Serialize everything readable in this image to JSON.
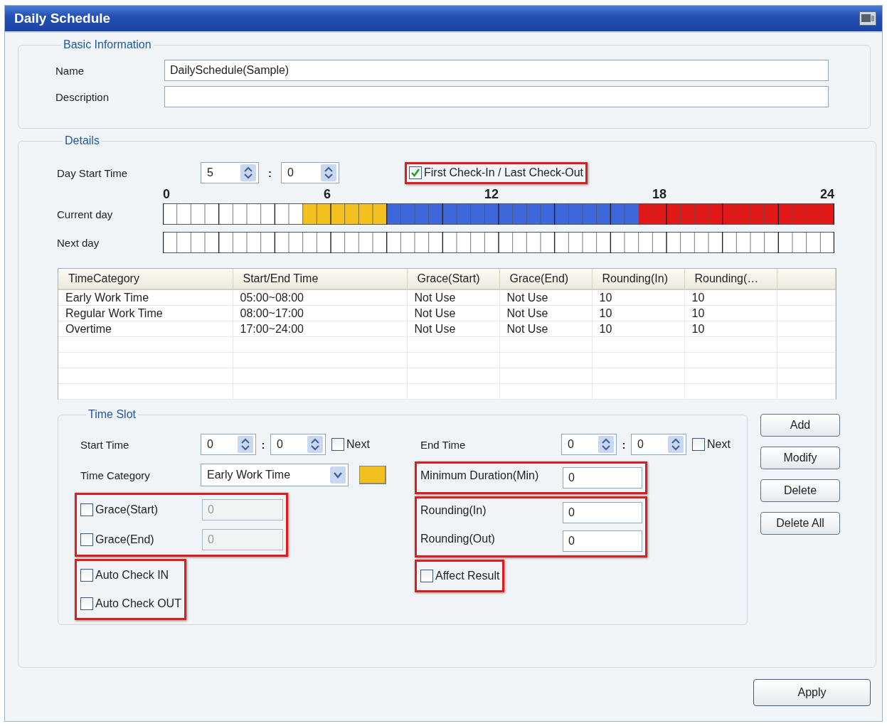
{
  "window": {
    "title": "Daily Schedule"
  },
  "basic_information": {
    "title": "Basic Information",
    "fields": [
      {
        "label": "Name",
        "value": "DailySchedule(Sample)"
      },
      {
        "label": "Description"
      }
    ]
  },
  "details": {
    "title": "Details",
    "day_start_time": {
      "label": "Day Start Time",
      "hour": "5",
      "separator": ":",
      "minute": "0"
    },
    "first_last_check": {
      "label": "First Check-In / Last Check-Out",
      "checked": true,
      "highlighted": true
    },
    "timeline": {
      "ticks": [
        "0",
        "6",
        "12",
        "18",
        "24"
      ],
      "rows": [
        {
          "label": "Current day",
          "filled": true
        },
        {
          "label": "Next day",
          "filled": false
        }
      ]
    },
    "table": {
      "columns": [
        "TimeCategory",
        "Start/End Time",
        "Grace(Start)",
        "Grace(End)",
        "Rounding(In)",
        "Rounding(…"
      ],
      "rows": [
        {
          "cells": [
            "Early Work Time",
            "05:00~08:00",
            "Not Use",
            "Not Use",
            "10",
            "10"
          ],
          "color": "#f2c01f"
        },
        {
          "cells": [
            "Regular Work Time",
            "08:00~17:00",
            "Not Use",
            "Not Use",
            "10",
            "10"
          ],
          "color": "#3f67dc"
        },
        {
          "cells": [
            "Overtime",
            "17:00~24:00",
            "Not Use",
            "Not Use",
            "10",
            "10"
          ],
          "color": "#e01818"
        }
      ]
    },
    "time_slot": {
      "title": "Time Slot",
      "left": [
        {
          "kind": "time",
          "label": "Start Time",
          "hour": "0",
          "separator": ":",
          "minute": "0",
          "next_label": "Next",
          "next_checked": false
        },
        {
          "kind": "dropdown",
          "label": "Time Category",
          "value": "Early Work Time",
          "color": "#f2c01f"
        },
        {
          "kind": "group",
          "highlighted": true,
          "items": [
            {
              "kind": "check_field",
              "label": "Grace(Start)",
              "checked": false,
              "value": "0",
              "disabled": true
            },
            {
              "kind": "check_field",
              "label": "Grace(End)",
              "checked": false,
              "value": "0",
              "disabled": true
            }
          ]
        },
        {
          "kind": "group",
          "highlighted": true,
          "items": [
            {
              "kind": "checkbox",
              "label": "Auto Check IN",
              "checked": false
            },
            {
              "kind": "checkbox",
              "label": "Auto Check OUT",
              "checked": false
            }
          ]
        }
      ],
      "right": [
        {
          "kind": "time",
          "label": "End Time",
          "hour": "0",
          "separator": ":",
          "minute": "0",
          "next_label": "Next",
          "next_checked": false
        },
        {
          "kind": "group",
          "highlighted": true,
          "items": [
            {
              "kind": "text_field",
              "label": "Minimum Duration(Min)",
              "value": "0",
              "disabled": false
            }
          ]
        },
        {
          "kind": "group",
          "highlighted": true,
          "items": [
            {
              "kind": "text_field",
              "label": "Rounding(In)",
              "value": "0",
              "disabled": false
            },
            {
              "kind": "text_field",
              "label": "Rounding(Out)",
              "value": "0",
              "disabled": false
            }
          ]
        },
        {
          "kind": "group",
          "highlighted": true,
          "items": [
            {
              "kind": "checkbox",
              "label": "Affect Result",
              "checked": false
            }
          ]
        }
      ]
    },
    "buttons": [
      "Add",
      "Modify",
      "Delete",
      "Delete All"
    ]
  },
  "apply_button": "Apply"
}
